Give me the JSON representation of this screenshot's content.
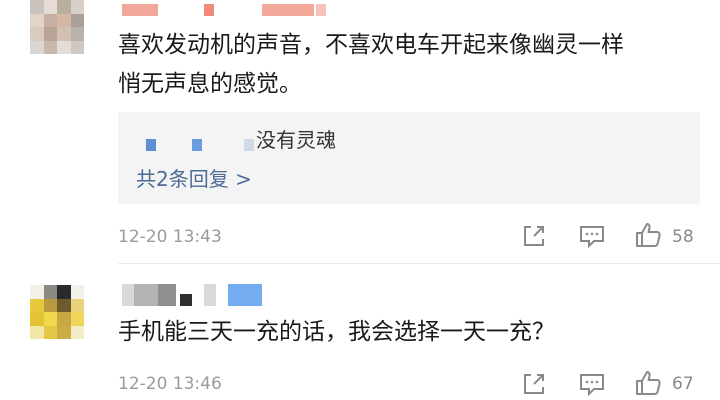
{
  "comments": [
    {
      "text_line1": "喜欢发动机的声音，不喜欢电车开起来像幽灵一样",
      "text_line2": "悄无声息的感觉。",
      "reply_preview": {
        "text": "没有灵魂",
        "more_link": "共2条回复 >"
      },
      "time": "12-20 13:43",
      "likes": "58",
      "icons": [
        "share-icon",
        "comment-icon",
        "thumbs-up-icon"
      ]
    },
    {
      "text_line1": "手机能三天一充的话，我会选择一天一充？",
      "time": "12-20 13:46",
      "likes": "67",
      "icons": [
        "share-icon",
        "comment-icon",
        "thumbs-up-icon"
      ]
    }
  ],
  "colors": {
    "link": "#4a6c96",
    "meta": "#9b9b9b",
    "reply_bg": "#f4f4f4",
    "mosaic_red": "#f08a7a",
    "mosaic_blue": "#6b9ee0",
    "mosaic_yellow": "#e6c93a"
  }
}
